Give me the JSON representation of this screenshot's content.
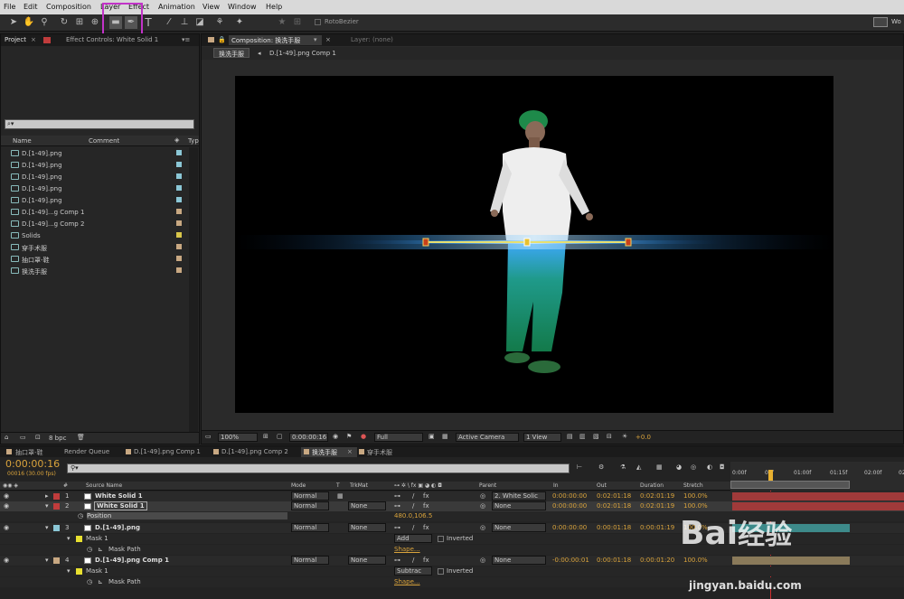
{
  "menu": [
    "File",
    "Edit",
    "Composition",
    "Layer",
    "Effect",
    "Animation",
    "View",
    "Window",
    "Help"
  ],
  "toolbar": {
    "rotobezier": "RotoBezier",
    "workspace_short": "Wo"
  },
  "left_tabs": {
    "project": "Project",
    "effect_controls": "Effect Controls: White Solid 1"
  },
  "project": {
    "search_placeholder": "⌕▾",
    "columns": {
      "name": "Name",
      "comment": "Comment",
      "type": "Typ"
    },
    "items": [
      {
        "name": "D.[1-49].png",
        "color": "#8bc7d6"
      },
      {
        "name": "D.[1-49].png",
        "color": "#8bc7d6"
      },
      {
        "name": "D.[1-49].png",
        "color": "#8bc7d6"
      },
      {
        "name": "D.[1-49].png",
        "color": "#8bc7d6"
      },
      {
        "name": "D.[1-49].png",
        "color": "#8bc7d6"
      },
      {
        "name": "D.[1-49]...g Comp 1",
        "color": "#c8a882"
      },
      {
        "name": "D.[1-49]...g Comp 2",
        "color": "#c8a882"
      },
      {
        "name": "Solids",
        "color": "#d8c64a"
      },
      {
        "name": "穿手术服",
        "color": "#c8a882"
      },
      {
        "name": "抽口罩-鞋",
        "color": "#c8a882"
      },
      {
        "name": "换洗手服",
        "color": "#c8a882"
      }
    ],
    "bpc": "8 bpc"
  },
  "comp_panel": {
    "tab": "Composition: 换洗手服",
    "layer_tab": "Layer: (none)",
    "breadcrumb_active": "换洗手服",
    "breadcrumb_next": "D.[1-49].png Comp 1",
    "zoom": "100%",
    "timecode": "0:00:00:16",
    "resolution": "Full",
    "camera": "Active Camera",
    "views": "1 View",
    "exposure": "+0.0"
  },
  "timeline_tabs": [
    "抽口罩-鞋",
    "Render Queue",
    "D.[1-49].png Comp 1",
    "D.[1-49].png Comp 2",
    "换洗手服",
    "穿手术服"
  ],
  "timeline": {
    "timecode": "0:00:00:16",
    "frame_info": "00016 (30.00 fps)",
    "columns": {
      "num": "#",
      "source": "Source Name",
      "mode": "Mode",
      "t": "T",
      "trkmat": "TrkMat",
      "parent": "Parent",
      "in": "In",
      "out": "Out",
      "duration": "Duration",
      "stretch": "Stretch"
    },
    "ruler": [
      "0:00f",
      "00f",
      "01:00f",
      "01:15f",
      "02:00f",
      "02"
    ],
    "layers": [
      {
        "num": "1",
        "name": "White Solid 1",
        "mode": "Normal",
        "trkmat": "",
        "parent": "2. White Solic",
        "in": "0:00:00:00",
        "out": "0:02:01:18",
        "dur": "0:02:01:19",
        "stretch": "100.0%",
        "color": "#c03c3c"
      },
      {
        "num": "2",
        "name": "White Solid 1",
        "mode": "Normal",
        "trkmat": "None",
        "parent": "None",
        "in": "0:00:00:00",
        "out": "0:02:01:18",
        "dur": "0:02:01:19",
        "stretch": "100.0%",
        "color": "#c03c3c"
      },
      {
        "num": "3",
        "name": "D.[1-49].png",
        "mode": "Normal",
        "trkmat": "None",
        "parent": "None",
        "in": "0:00:00:00",
        "out": "0:00:01:18",
        "dur": "0:00:01:19",
        "stretch": "100.0%",
        "color": "#8bc7d6"
      },
      {
        "num": "4",
        "name": "D.[1-49].png Comp 1",
        "mode": "Normal",
        "trkmat": "None",
        "parent": "None",
        "in": "-0:00:00:01",
        "out": "0:00:01:18",
        "dur": "0:00:01:20",
        "stretch": "100.0%",
        "color": "#c8a882"
      }
    ],
    "position_label": "Position",
    "position_value": "480.0,106.5",
    "mask1_label": "Mask 1",
    "mask_path": "Mask Path",
    "add": "Add",
    "subtract": "Subtrac",
    "inverted": "Inverted",
    "shape": "Shape..."
  },
  "watermark": {
    "brand": "Bai",
    "brand_cn": "经验",
    "url": "jingyan.baidu.com"
  }
}
